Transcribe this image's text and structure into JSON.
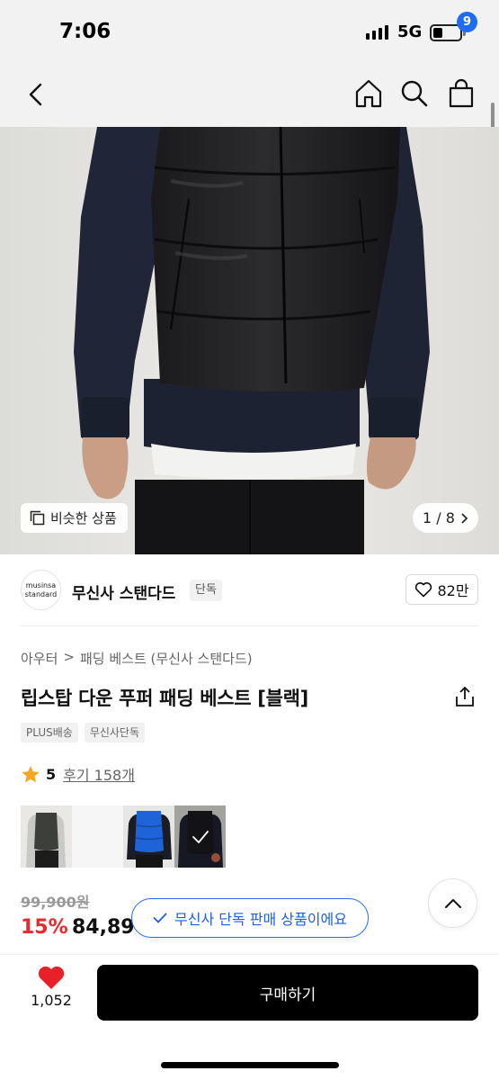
{
  "status": {
    "time": "7:06",
    "network": "5G"
  },
  "nav": {
    "cart_count": "9"
  },
  "gallery": {
    "similar_label": "비슷한 상품",
    "counter": "1 / 8"
  },
  "brand": {
    "logo_line1": "musinsa",
    "logo_line2": "standard",
    "name": "무신사 스탠다드",
    "tag": "단독",
    "likes": "82만"
  },
  "breadcrumb": [
    "아우터",
    "패딩 베스트 (무신사 스탠다드)"
  ],
  "product": {
    "title": "립스탑 다운 푸퍼 패딩 베스트 [블랙]",
    "tags": [
      "PLUS배송",
      "무신사단독"
    ],
    "rating": "5",
    "reviews": "후기 158개",
    "original_price": "99,900원",
    "discount": "15%",
    "price": "84,89"
  },
  "toast": {
    "label": "무신사 단독 판매 상품이에요"
  },
  "bottom": {
    "wish_count": "1,052",
    "buy_label": "구매하기"
  },
  "colors": {
    "accent": "#1e6cf2",
    "sale": "#e9292d",
    "heart": "#e8202a",
    "star": "#f5a623"
  }
}
